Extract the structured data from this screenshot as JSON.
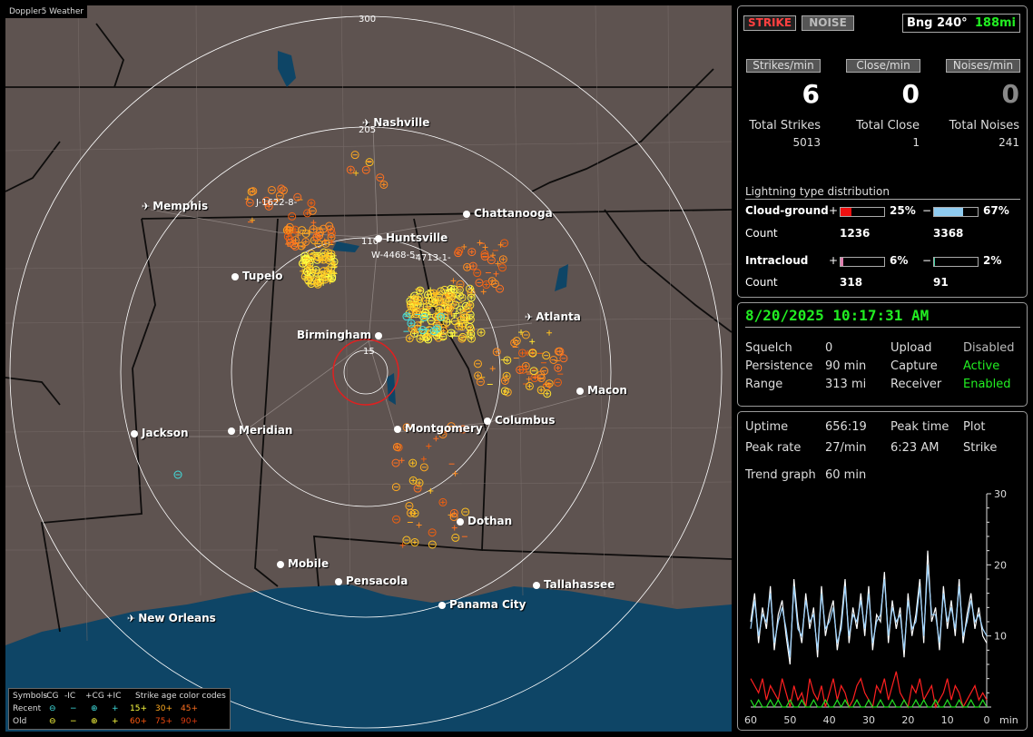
{
  "app_title": "Doppler5 Weather",
  "map": {
    "cities": [
      {
        "name": "Nashville",
        "kind": "airport"
      },
      {
        "name": "Memphis",
        "kind": "airport"
      },
      {
        "name": "Chattanooga",
        "kind": "city"
      },
      {
        "name": "Huntsville",
        "kind": "city"
      },
      {
        "name": "Tupelo",
        "kind": "city"
      },
      {
        "name": "Birmingham",
        "kind": "city"
      },
      {
        "name": "Atlanta",
        "kind": "airport"
      },
      {
        "name": "Macon",
        "kind": "city"
      },
      {
        "name": "Jackson",
        "kind": "city"
      },
      {
        "name": "Meridian",
        "kind": "city"
      },
      {
        "name": "Montgomery",
        "kind": "city"
      },
      {
        "name": "Columbus",
        "kind": "city"
      },
      {
        "name": "Dothan",
        "kind": "city"
      },
      {
        "name": "Mobile",
        "kind": "city"
      },
      {
        "name": "Pensacola",
        "kind": "city"
      },
      {
        "name": "Tallahassee",
        "kind": "city"
      },
      {
        "name": "Panama City",
        "kind": "city"
      },
      {
        "name": "New Orleans",
        "kind": "airport"
      }
    ],
    "range_labels": [
      "300",
      "205",
      "110",
      "15"
    ],
    "storm_tags": [
      "J-1622-8-",
      "W-4468-5-",
      "-4713-1-"
    ],
    "legend": {
      "symbols_label": "Symbols",
      "headers": [
        "-CG",
        "-IC",
        "+CG",
        "+IC"
      ],
      "age_label": "Strike age color codes",
      "recent_label": "Recent",
      "old_label": "Old",
      "recent_symbols": [
        "⊖",
        "−",
        "⊕",
        "+"
      ],
      "old_symbols": [
        "⊖",
        "−",
        "⊕",
        "+"
      ],
      "recent_ages": [
        "15+",
        "30+",
        "45+"
      ],
      "old_ages": [
        "60+",
        "75+",
        "90+"
      ],
      "age_colors": [
        "#ffff40",
        "#ffaa20",
        "#ff7020",
        "#ff5a10",
        "#ee4a10",
        "#dd3a10"
      ]
    }
  },
  "status": {
    "strike_button": "STRIKE",
    "noise_button": "NOISE",
    "bearing": "Bng 240°",
    "distance": "188mi",
    "strikes_min_label": "Strikes/min",
    "close_min_label": "Close/min",
    "noises_min_label": "Noises/min",
    "strikes_min": "6",
    "close_min": "0",
    "noises_min": "0",
    "total_strikes_label": "Total Strikes",
    "total_close_label": "Total Close",
    "total_noises_label": "Total Noises",
    "total_strikes": "5013",
    "total_close": "1",
    "total_noises": "241",
    "distribution_title": "Lightning type distribution",
    "cloud_ground_label": "Cloud-ground",
    "intracloud_label": "Intracloud",
    "count_label": "Count",
    "plus_sign": "+",
    "minus_sign": "−",
    "cg_pos_pct": "25%",
    "cg_neg_pct": "67%",
    "cg_pos_count": "1236",
    "cg_neg_count": "3368",
    "ic_pos_pct": "6%",
    "ic_neg_pct": "2%",
    "ic_pos_count": "318",
    "ic_neg_count": "91",
    "cg_pos_fill": 0.25,
    "cg_neg_fill": 0.67,
    "ic_pos_fill": 0.06,
    "ic_neg_fill": 0.02
  },
  "info": {
    "datetime": "8/20/2025 10:17:31 AM",
    "squelch_label": "Squelch",
    "squelch": "0",
    "persistence_label": "Persistence",
    "persistence": "90 min",
    "range_label": "Range",
    "range": "313 mi",
    "upload_label": "Upload",
    "upload": "Disabled",
    "capture_label": "Capture",
    "capture": "Active",
    "receiver_label": "Receiver",
    "receiver": "Enabled"
  },
  "stats": {
    "uptime_label": "Uptime",
    "uptime": "656:19",
    "peak_time_label": "Peak time",
    "peak_time": "6:23 AM",
    "plot_label": "Plot",
    "plot": "Strike",
    "peak_rate_label": "Peak rate",
    "peak_rate": "27/min",
    "trend_label": "Trend graph",
    "trend": "60 min"
  },
  "chart_data": {
    "type": "line",
    "x": [
      60,
      59,
      58,
      57,
      56,
      55,
      54,
      53,
      52,
      51,
      50,
      49,
      48,
      47,
      46,
      45,
      44,
      43,
      42,
      41,
      40,
      39,
      38,
      37,
      36,
      35,
      34,
      33,
      32,
      31,
      30,
      29,
      28,
      27,
      26,
      25,
      24,
      23,
      22,
      21,
      20,
      19,
      18,
      17,
      16,
      15,
      14,
      13,
      12,
      11,
      10,
      9,
      8,
      7,
      6,
      5,
      4,
      3,
      2,
      1,
      0
    ],
    "xlabel": "min",
    "x_ticks": [
      60,
      50,
      40,
      30,
      20,
      10,
      0
    ],
    "y_ticks": [
      10,
      20,
      30
    ],
    "ylim": [
      0,
      30
    ],
    "xlim": [
      60,
      0
    ],
    "series": [
      {
        "color": "#ffffff",
        "values": [
          12,
          16,
          9,
          14,
          11,
          17,
          8,
          13,
          15,
          10,
          6,
          18,
          12,
          9,
          16,
          11,
          14,
          7,
          17,
          10,
          13,
          15,
          8,
          12,
          18,
          9,
          14,
          11,
          16,
          10,
          17,
          8,
          13,
          12,
          19,
          9,
          15,
          11,
          14,
          7,
          16,
          10,
          13,
          18,
          9,
          22,
          12,
          14,
          8,
          17,
          11,
          15,
          10,
          18,
          9,
          13,
          16,
          11,
          14,
          10,
          9
        ]
      },
      {
        "color": "#9fd4ff",
        "values": [
          11,
          15,
          10,
          13,
          12,
          16,
          9,
          12,
          14,
          11,
          7,
          17,
          11,
          10,
          15,
          12,
          13,
          8,
          16,
          11,
          12,
          14,
          9,
          11,
          17,
          10,
          13,
          12,
          15,
          11,
          16,
          9,
          12,
          13,
          18,
          10,
          14,
          12,
          13,
          8,
          15,
          11,
          12,
          17,
          10,
          20,
          13,
          13,
          9,
          16,
          12,
          14,
          11,
          17,
          10,
          12,
          15,
          12,
          13,
          11,
          10
        ]
      },
      {
        "color": "#ff2020",
        "values": [
          4,
          3,
          2,
          4,
          1,
          3,
          2,
          1,
          4,
          2,
          0,
          3,
          1,
          2,
          0,
          4,
          2,
          1,
          3,
          0,
          2,
          4,
          1,
          3,
          2,
          0,
          1,
          3,
          4,
          2,
          1,
          0,
          3,
          2,
          4,
          1,
          3,
          5,
          2,
          1,
          0,
          3,
          2,
          4,
          1,
          2,
          3,
          0,
          1,
          2,
          4,
          1,
          3,
          2,
          0,
          1,
          2,
          3,
          1,
          2,
          1
        ]
      },
      {
        "color": "#22dd22",
        "values": [
          1,
          0,
          1,
          0,
          0,
          1,
          0,
          1,
          0,
          0,
          1,
          0,
          0,
          1,
          0,
          0,
          1,
          0,
          0,
          1,
          0,
          0,
          1,
          0,
          1,
          0,
          0,
          1,
          0,
          0,
          1,
          0,
          0,
          1,
          0,
          0,
          1,
          0,
          0,
          1,
          0,
          0,
          1,
          0,
          1,
          0,
          0,
          1,
          0,
          0,
          1,
          0,
          0,
          1,
          0,
          0,
          1,
          0,
          0,
          1,
          0
        ]
      }
    ]
  }
}
